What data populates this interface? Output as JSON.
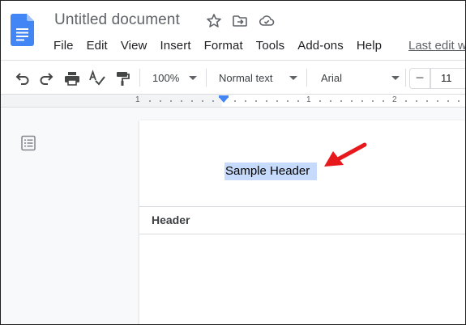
{
  "document": {
    "title": "Untitled document"
  },
  "menu": {
    "items": [
      "File",
      "Edit",
      "View",
      "Insert",
      "Format",
      "Tools",
      "Add-ons",
      "Help"
    ],
    "last_edit": "Last edit w"
  },
  "toolbar": {
    "zoom": "100%",
    "style": "Normal text",
    "font": "Arial",
    "font_size": "11",
    "minus": "−"
  },
  "ruler": {
    "numbers": [
      "1",
      "1",
      "2"
    ]
  },
  "page": {
    "header_text": "Sample Header",
    "header_label": "Header"
  },
  "colors": {
    "accent": "#4285f4",
    "selection": "#c6dafc",
    "annotation": "#e8191c",
    "docs_blue": "#4285f4"
  }
}
